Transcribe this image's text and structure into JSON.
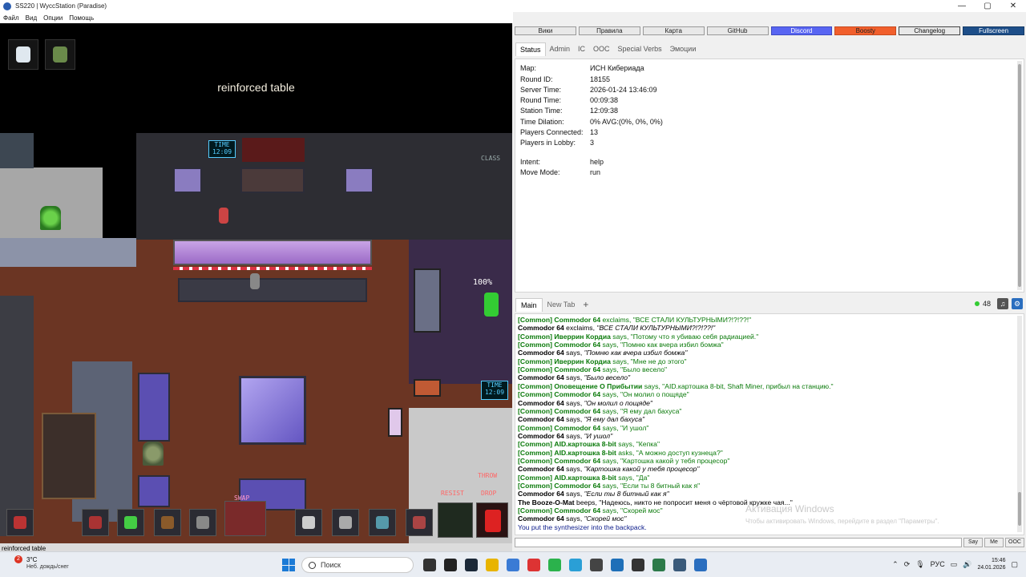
{
  "window": {
    "title": "SS220 | WyccStation (Paradise)",
    "controls": [
      "—",
      "▢",
      "✕"
    ]
  },
  "menu": [
    "Файл",
    "Вид",
    "Опции",
    "Помощь"
  ],
  "game": {
    "hover_label": "reinforced table",
    "status_text": "reinforced table",
    "screen_time_1": "TIME\n12:09",
    "screen_time_2": "TIME\n12:09",
    "percent": "100%",
    "hud_labels": {
      "throw": "THROW",
      "drop": "DROP",
      "resist": "RESIST",
      "swap": "SWAP",
      "class": "CLASS"
    }
  },
  "top_buttons": [
    {
      "label": "Вики",
      "style": ""
    },
    {
      "label": "Правила",
      "style": ""
    },
    {
      "label": "Карта",
      "style": ""
    },
    {
      "label": "GitHub",
      "style": ""
    },
    {
      "label": "Discord",
      "style": "discord"
    },
    {
      "label": "Boosty",
      "style": "boosty"
    },
    {
      "label": "Changelog",
      "style": "changelog"
    },
    {
      "label": "Fullscreen",
      "style": "fullscreen"
    }
  ],
  "stat_tabs": [
    "Status",
    "Admin",
    "IC",
    "OOC",
    "Special Verbs",
    "Эмоции"
  ],
  "status": {
    "map": {
      "k": "Map:",
      "v": "ИСН Кибериада"
    },
    "round_id": {
      "k": "Round ID:",
      "v": "18155"
    },
    "server_time": {
      "k": "Server Time:",
      "v": "2026-01-24 13:46:09"
    },
    "round_time": {
      "k": "Round Time:",
      "v": "00:09:38"
    },
    "station_time": {
      "k": "Station Time:",
      "v": "12:09:38"
    },
    "time_dilation": {
      "k": "Time Dilation:",
      "v": "0% AVG:(0%, 0%, 0%)"
    },
    "players_connected": {
      "k": "Players Connected:",
      "v": "13"
    },
    "players_lobby": {
      "k": "Players in Lobby:",
      "v": "3"
    },
    "intent": {
      "k": "Intent:",
      "v": "help"
    },
    "move_mode": {
      "k": "Move Mode:",
      "v": "run"
    }
  },
  "chat": {
    "tabs": [
      "Main",
      "New Tab"
    ],
    "add_tab": "+",
    "online_count": "48",
    "watermark_title": "Активация Windows",
    "watermark_sub": "Чтобы активировать Windows, перейдите в раздел \"Параметры\".",
    "buttons": [
      "Say",
      "Me",
      "OOC"
    ],
    "messages": [
      {
        "ch": "[Common]",
        "nm": "Commodor 64",
        "verb": "exclaims,",
        "text": "\"ВСЕ СТАЛИ КУЛЬТУРНЫМИ?!?!??!\"",
        "kind": "green"
      },
      {
        "ch": "",
        "nm": "Commodor 64",
        "verb": "exclaims,",
        "text": "\"ВСЕ СТАЛИ КУЛЬТУРНЫМИ?!?!??!\"",
        "kind": "black"
      },
      {
        "ch": "[Common]",
        "nm": "Иверрин Кордиа",
        "verb": "says,",
        "text": "\"Потому что я убиваю себя радиацией.\"",
        "kind": "green"
      },
      {
        "ch": "[Common]",
        "nm": "Commodor 64",
        "verb": "says,",
        "text": "\"Помню как вчера избил бомжа\"",
        "kind": "green"
      },
      {
        "ch": "",
        "nm": "Commodor 64",
        "verb": "says,",
        "text": "\"Помню как вчера избил бомжа\"",
        "kind": "black"
      },
      {
        "ch": "[Common]",
        "nm": "Иверрин Кордиа",
        "verb": "says,",
        "text": "\"Мне не до этого\"",
        "kind": "green"
      },
      {
        "ch": "[Common]",
        "nm": "Commodor 64",
        "verb": "says,",
        "text": "\"Было весело\"",
        "kind": "green"
      },
      {
        "ch": "",
        "nm": "Commodor 64",
        "verb": "says,",
        "text": "\"Было весело\"",
        "kind": "black"
      },
      {
        "ch": "[Common]",
        "nm": "Оповещение О Прибытии",
        "verb": "says,",
        "text": "\"AID.картошка 8-bit, Shaft Miner, прибыл на станцию.\"",
        "kind": "green"
      },
      {
        "ch": "[Common]",
        "nm": "Commodor 64",
        "verb": "says,",
        "text": "\"Он молил о пощяде\"",
        "kind": "green"
      },
      {
        "ch": "",
        "nm": "Commodor 64",
        "verb": "says,",
        "text": "\"Он молил о пощяде\"",
        "kind": "black"
      },
      {
        "ch": "[Common]",
        "nm": "Commodor 64",
        "verb": "says,",
        "text": "\"Я ему дал бахуса\"",
        "kind": "green"
      },
      {
        "ch": "",
        "nm": "Commodor 64",
        "verb": "says,",
        "text": "\"Я ему дал бахуса\"",
        "kind": "black"
      },
      {
        "ch": "[Common]",
        "nm": "Commodor 64",
        "verb": "says,",
        "text": "\"И ушол\"",
        "kind": "green"
      },
      {
        "ch": "",
        "nm": "Commodor 64",
        "verb": "says,",
        "text": "\"И ушол\"",
        "kind": "black"
      },
      {
        "ch": "[Common]",
        "nm": "AID.картошка 8-bit",
        "verb": "says,",
        "text": "\"Кепка\"",
        "kind": "green"
      },
      {
        "ch": "[Common]",
        "nm": "AID.картошка 8-bit",
        "verb": "asks,",
        "text": "\"А можно доступ кузнеца?\"",
        "kind": "green"
      },
      {
        "ch": "[Common]",
        "nm": "Commodor 64",
        "verb": "says,",
        "text": "\"Картошка какой у тебя процесор\"",
        "kind": "green"
      },
      {
        "ch": "",
        "nm": "Commodor 64",
        "verb": "says,",
        "text": "\"Картошка какой у тебя процесор\"",
        "kind": "black"
      },
      {
        "ch": "[Common]",
        "nm": "AID.картошка 8-bit",
        "verb": "says,",
        "text": "\"Да\"",
        "kind": "green"
      },
      {
        "ch": "[Common]",
        "nm": "Commodor 64",
        "verb": "says,",
        "text": "\"Если ты 8 битный как я\"",
        "kind": "green"
      },
      {
        "ch": "",
        "nm": "Commodor 64",
        "verb": "says,",
        "text": "\"Если ты 8 битный как я\"",
        "kind": "black"
      },
      {
        "ch": "",
        "nm": "The Booze-O-Mat",
        "verb": "beeps,",
        "text": "\"Надеюсь, никто не попросит меня о чёртовой кружке чая...\"",
        "kind": "black-plain"
      },
      {
        "ch": "[Common]",
        "nm": "Commodor 64",
        "verb": "says,",
        "text": "\"Скорей мос\"",
        "kind": "green"
      },
      {
        "ch": "",
        "nm": "Commodor 64",
        "verb": "says,",
        "text": "\"Скорей мос\"",
        "kind": "black"
      },
      {
        "ch": "",
        "nm": "",
        "verb": "",
        "text": "You put the synthesizer into the backpack.",
        "kind": "sys"
      }
    ]
  },
  "taskbar": {
    "weather_badge": "2",
    "temp": "3°C",
    "weather_desc": "Неб. дождь/снег",
    "search": "Поиск",
    "lang": "РУС",
    "time": "15:46",
    "date": "24.01.2026",
    "app_colors": [
      "#333",
      "#222",
      "#1b2838",
      "#e8b400",
      "#3a7bd5",
      "#d33",
      "#2bb24c",
      "#2a9fd6",
      "#444",
      "#1e6fb8",
      "#333",
      "#2c7a4a",
      "#3a5a7a",
      "#2a6ebf"
    ]
  }
}
